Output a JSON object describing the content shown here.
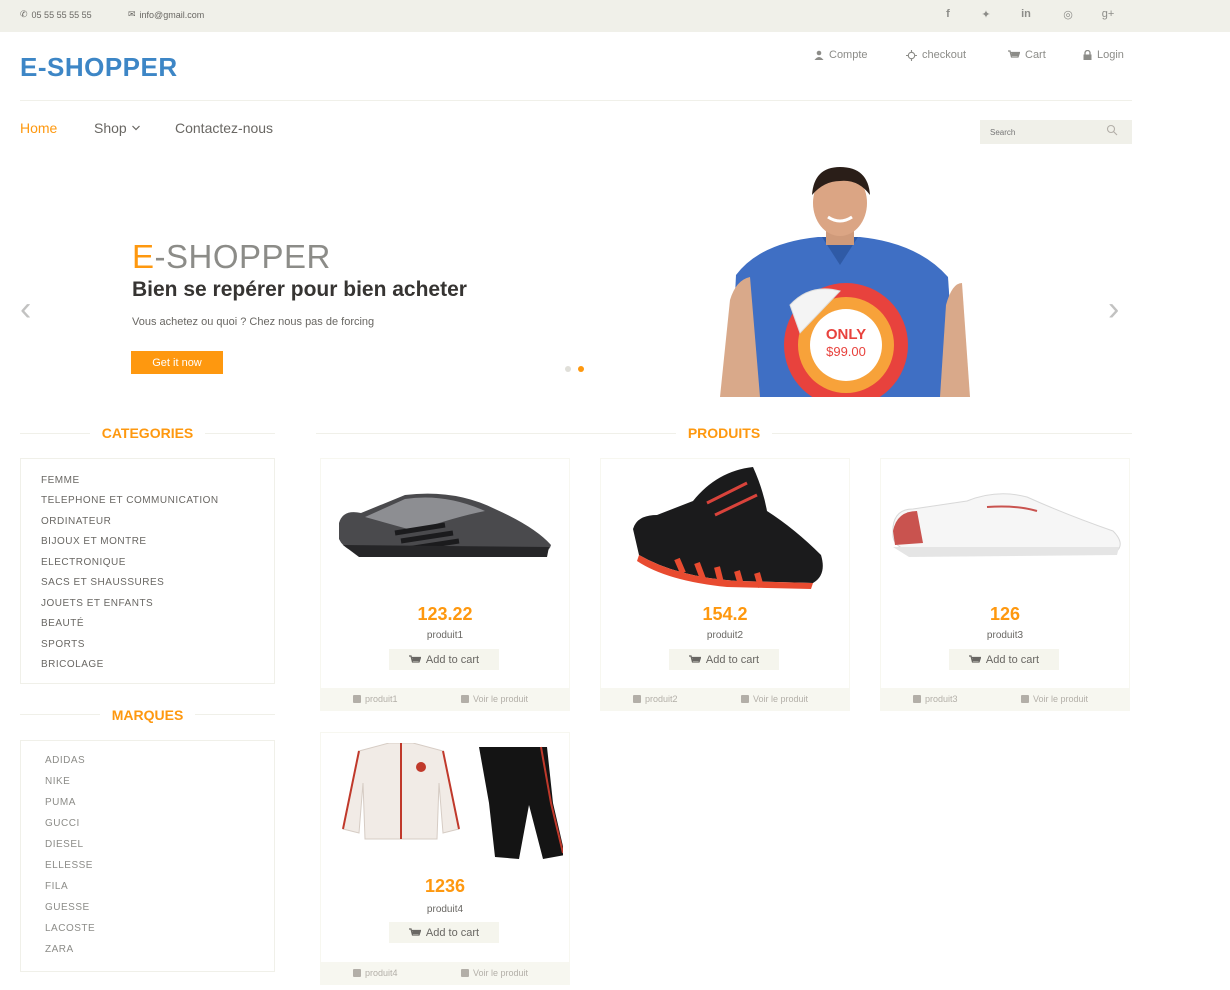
{
  "topbar": {
    "phone": "05 55 55 55 55",
    "email": "info@gmail.com",
    "social": [
      "f",
      "t",
      "in",
      "d",
      "g+"
    ]
  },
  "header": {
    "logo": "E-SHOPPER",
    "links": [
      {
        "label": "Compte",
        "icon": "user-icon"
      },
      {
        "label": "checkout",
        "icon": "crosshairs-icon"
      },
      {
        "label": "Cart",
        "icon": "cart-icon"
      },
      {
        "label": "Login",
        "icon": "lock-icon"
      }
    ]
  },
  "nav": {
    "home": "Home",
    "shop": "Shop",
    "contact": "Contactez-nous",
    "search_placeholder": "Search"
  },
  "hero": {
    "brand_e": "E",
    "brand_rest": "-SHOPPER",
    "title": "Bien se repérer pour bien acheter",
    "text": "Vous achetez ou quoi ? Chez nous pas de forcing",
    "button": "Get it now",
    "badge_top": "ONLY",
    "badge_price": "$99.00",
    "active_slide": 2,
    "slide_count": 2
  },
  "categories": {
    "title": "CATEGORIES",
    "items": [
      "FEMME",
      "TELEPHONE ET COMMUNICATION",
      "ORDINATEUR",
      "BIJOUX ET MONTRE",
      "ELECTRONIQUE",
      "SACS ET SHAUSSURES",
      "JOUETS ET ENFANTS",
      "BEAUTÉ",
      "SPORTS",
      "BRICOLAGE"
    ]
  },
  "brands": {
    "title": "MARQUES",
    "items": [
      "ADIDAS",
      "NIKE",
      "PUMA",
      "GUCCI",
      "DIESEL",
      "ELLESSE",
      "FILA",
      "GUESSE",
      "LACOSTE",
      "ZARA"
    ]
  },
  "products": {
    "title": "PRODUITS",
    "add_to_cart": "Add to cart",
    "view_label": "Voir le produit",
    "items": [
      {
        "price": "123.22",
        "name": "produit1"
      },
      {
        "price": "154.2",
        "name": "produit2"
      },
      {
        "price": "126",
        "name": "produit3"
      },
      {
        "price": "1236",
        "name": "produit4"
      }
    ]
  },
  "colors": {
    "accent": "#fe980f",
    "logo": "#3d86c6",
    "topbar_bg": "#f0f0e9"
  }
}
